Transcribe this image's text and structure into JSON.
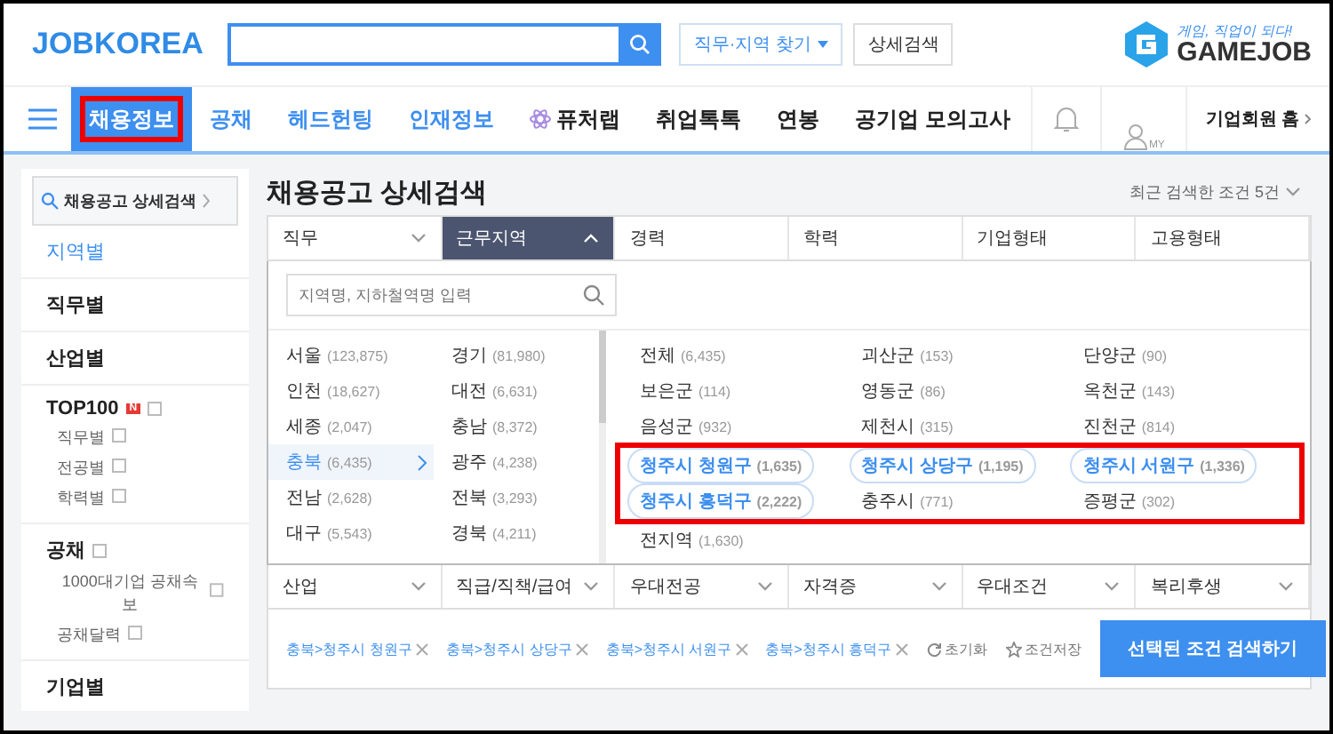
{
  "header": {
    "logo": "JOBKOREA",
    "find_button": "직무·지역 찾기",
    "detail_button": "상세검색",
    "promo": {
      "tagline": "게임, 직업이 되다!",
      "brand": "GAMEJOB"
    }
  },
  "nav": {
    "items": [
      {
        "label": "채용정보",
        "selected": true,
        "highlighted": true,
        "kind": "accent"
      },
      {
        "label": "공채",
        "selected": false,
        "highlighted": false,
        "kind": "accent"
      },
      {
        "label": "헤드헌팅",
        "selected": false,
        "highlighted": false,
        "kind": "accent"
      },
      {
        "label": "인재정보",
        "selected": false,
        "highlighted": false,
        "kind": "accent"
      },
      {
        "label": "퓨처랩",
        "selected": false,
        "highlighted": false,
        "kind": "lab"
      },
      {
        "label": "취업톡톡",
        "selected": false,
        "highlighted": false,
        "kind": "plain"
      },
      {
        "label": "연봉",
        "selected": false,
        "highlighted": false,
        "kind": "plain"
      },
      {
        "label": "공기업 모의고사",
        "selected": false,
        "highlighted": false,
        "kind": "plain"
      }
    ],
    "my_label": "MY",
    "corp_home": "기업회원 홈"
  },
  "sidebar": {
    "search_button": "채용공고 상세검색",
    "sections": [
      {
        "label": "지역별",
        "selected": true
      },
      {
        "label": "직무별",
        "selected": false
      },
      {
        "label": "산업별",
        "selected": false
      },
      {
        "label": "TOP100",
        "selected": false,
        "badge": "N",
        "children": [
          {
            "label": "직무별"
          },
          {
            "label": "전공별"
          },
          {
            "label": "학력별"
          }
        ]
      },
      {
        "label": "공채",
        "selected": false,
        "children": [
          {
            "label": "1000대기업 공채속보"
          },
          {
            "label": "공채달력"
          }
        ]
      },
      {
        "label": "기업별",
        "selected": false
      }
    ]
  },
  "main": {
    "title": "채용공고 상세검색",
    "recent": "최근 검색한 조건 5건",
    "top_tabs": [
      {
        "label": "직무",
        "selected": false,
        "has_menu": true
      },
      {
        "label": "근무지역",
        "selected": true,
        "has_menu": true
      },
      {
        "label": "경력",
        "selected": false,
        "has_menu": false
      },
      {
        "label": "학력",
        "selected": false,
        "has_menu": false
      },
      {
        "label": "기업형태",
        "selected": false,
        "has_menu": false
      },
      {
        "label": "고용형태",
        "selected": false,
        "has_menu": false
      }
    ],
    "region_panel": {
      "search_placeholder": "지역명, 지하철역명 입력",
      "provinces": [
        {
          "name": "서울",
          "count": "(123,875)",
          "selected": false
        },
        {
          "name": "경기",
          "count": "(81,980)",
          "selected": false
        },
        {
          "name": "인천",
          "count": "(18,627)",
          "selected": false
        },
        {
          "name": "대전",
          "count": "(6,631)",
          "selected": false
        },
        {
          "name": "세종",
          "count": "(2,047)",
          "selected": false
        },
        {
          "name": "충남",
          "count": "(8,372)",
          "selected": false
        },
        {
          "name": "충북",
          "count": "(6,435)",
          "selected": true
        },
        {
          "name": "광주",
          "count": "(4,238)",
          "selected": false
        },
        {
          "name": "전남",
          "count": "(2,628)",
          "selected": false
        },
        {
          "name": "전북",
          "count": "(3,293)",
          "selected": false
        },
        {
          "name": "대구",
          "count": "(5,543)",
          "selected": false
        },
        {
          "name": "경북",
          "count": "(4,211)",
          "selected": false
        }
      ],
      "district_groups": [
        {
          "highlighted": false,
          "districts": [
            {
              "name": "전체",
              "count": "(6,435)",
              "selected": false
            },
            {
              "name": "괴산군",
              "count": "(153)",
              "selected": false
            },
            {
              "name": "단양군",
              "count": "(90)",
              "selected": false
            },
            {
              "name": "보은군",
              "count": "(114)",
              "selected": false
            },
            {
              "name": "영동군",
              "count": "(86)",
              "selected": false
            },
            {
              "name": "옥천군",
              "count": "(143)",
              "selected": false
            },
            {
              "name": "음성군",
              "count": "(932)",
              "selected": false
            },
            {
              "name": "제천시",
              "count": "(315)",
              "selected": false
            },
            {
              "name": "진천군",
              "count": "(814)",
              "selected": false
            }
          ]
        },
        {
          "highlighted": true,
          "districts": [
            {
              "name": "청주시 청원구",
              "count": "(1,635)",
              "selected": true
            },
            {
              "name": "청주시 상당구",
              "count": "(1,195)",
              "selected": true
            },
            {
              "name": "청주시 서원구",
              "count": "(1,336)",
              "selected": true
            },
            {
              "name": "청주시 흥덕구",
              "count": "(2,222)",
              "selected": true
            },
            {
              "name": "충주시",
              "count": "(771)",
              "selected": false
            },
            {
              "name": "증평군",
              "count": "(302)",
              "selected": false
            }
          ]
        },
        {
          "highlighted": false,
          "districts": [
            {
              "name": "전지역",
              "count": "(1,630)",
              "selected": false
            }
          ]
        }
      ]
    },
    "bottom_tabs": [
      {
        "label": "산업"
      },
      {
        "label": "직급/직책/급여"
      },
      {
        "label": "우대전공"
      },
      {
        "label": "자격증"
      },
      {
        "label": "우대조건"
      },
      {
        "label": "복리후생"
      }
    ],
    "selected_conditions": [
      "충북>청주시 청원구",
      "충북>청주시 상당구",
      "충북>청주시 서원구",
      "충북>청주시 흥덕구"
    ],
    "reset": "초기화",
    "save": "조건저장",
    "submit": "선택된 조건 검색하기"
  }
}
